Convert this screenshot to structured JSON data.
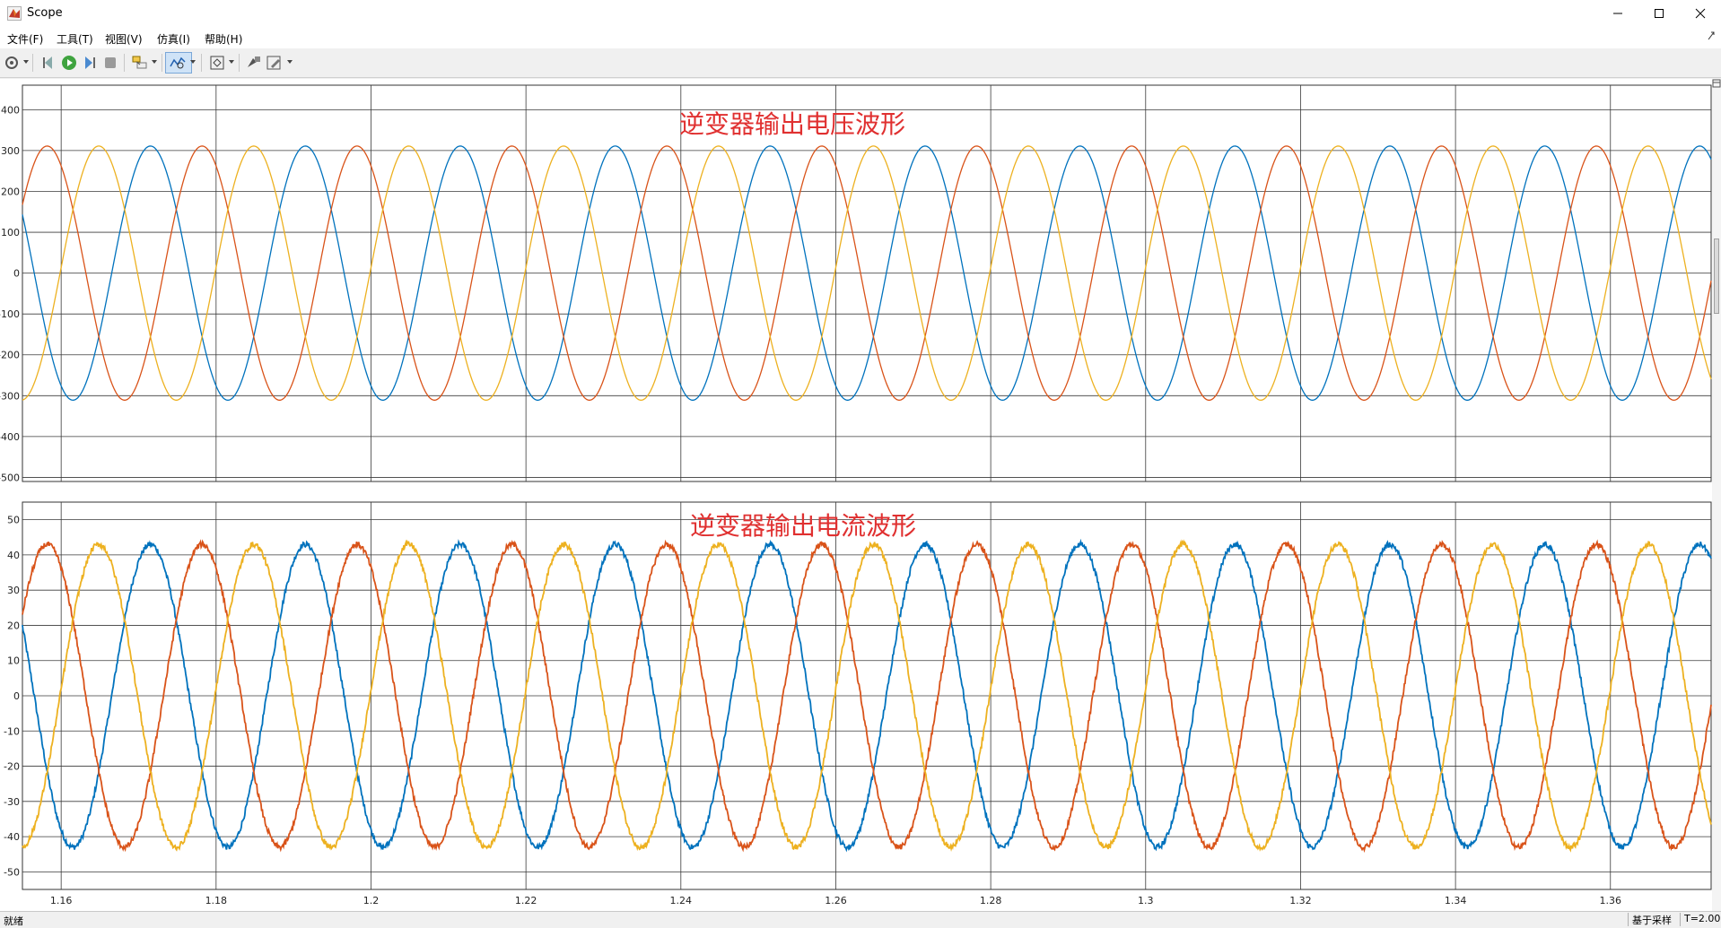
{
  "window": {
    "title": "Scope"
  },
  "menu": [
    "文件(F)",
    "工具(T)",
    "视图(V)",
    "仿真(I)",
    "帮助(H)"
  ],
  "toolbar": {
    "icons": [
      "settings-icon",
      "step-back-icon",
      "run-icon",
      "step-forward-icon",
      "stop-icon",
      "highlight-icon",
      "zoom-icon",
      "fit-view-icon",
      "write-access-icon",
      "edit-icon"
    ]
  },
  "status": {
    "left": "就绪",
    "mode": "基于采样",
    "time": "T=2.000"
  },
  "colors": {
    "phase_a": "#0072bd",
    "phase_b": "#d95319",
    "phase_c": "#edb120",
    "title": "#e03030"
  },
  "chart_data": [
    {
      "type": "line",
      "title": "逆变器输出电压波形",
      "xlim": [
        1.155,
        1.373
      ],
      "ylim": [
        -510,
        460
      ],
      "x_ticks": [
        1.16,
        1.18,
        1.2,
        1.22,
        1.24,
        1.26,
        1.28,
        1.3,
        1.32,
        1.34,
        1.36
      ],
      "y_ticks": [
        400,
        300,
        200,
        100,
        0,
        -100,
        -200,
        -300,
        -400,
        -500
      ],
      "grid": true,
      "waveform": "three-phase sine, 120° apart",
      "frequency_hz": 50,
      "amplitude": 311,
      "series": [
        {
          "color": "#0072bd",
          "amplitude": 311,
          "phase_deg": 0
        },
        {
          "color": "#d95319",
          "amplitude": 311,
          "phase_deg": -120
        },
        {
          "color": "#edb120",
          "amplitude": 311,
          "phase_deg": 120
        }
      ]
    },
    {
      "type": "line",
      "title": "逆变器输出电流波形",
      "xlim": [
        1.155,
        1.373
      ],
      "ylim": [
        -55,
        55
      ],
      "x_ticks": [
        1.16,
        1.18,
        1.2,
        1.22,
        1.24,
        1.26,
        1.28,
        1.3,
        1.32,
        1.34,
        1.36
      ],
      "x_tick_labels": [
        "1.16",
        "1.18",
        "1.2",
        "1.22",
        "1.24",
        "1.26",
        "1.28",
        "1.3",
        "1.32",
        "1.34",
        "1.36"
      ],
      "y_ticks": [
        50,
        40,
        30,
        20,
        10,
        0,
        -10,
        -20,
        -30,
        -40,
        -50
      ],
      "grid": true,
      "waveform": "three-phase sine, 120° apart, with ripple",
      "frequency_hz": 50,
      "amplitude": 43,
      "series": [
        {
          "color": "#0072bd",
          "amplitude": 43,
          "phase_deg": 0
        },
        {
          "color": "#d95319",
          "amplitude": 43,
          "phase_deg": -120
        },
        {
          "color": "#edb120",
          "amplitude": 43,
          "phase_deg": 120
        }
      ]
    }
  ]
}
